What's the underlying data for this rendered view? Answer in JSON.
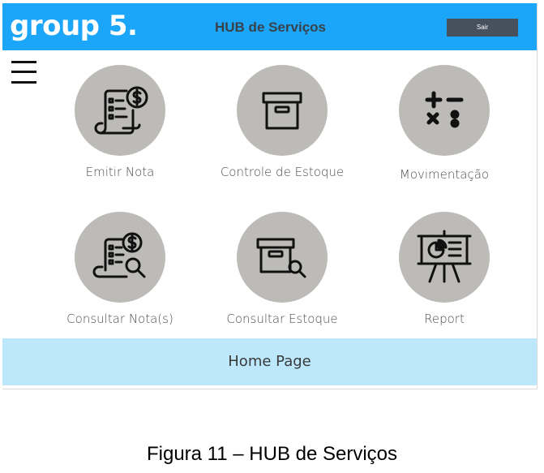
{
  "header": {
    "logo": "group 5.",
    "title": "HUB de Serviços",
    "logout_label": "Sair",
    "background_color": "#1ba6f9"
  },
  "menu": {
    "icon": "hamburger-menu-icon"
  },
  "tiles": [
    {
      "label": "Emitir Nota",
      "icon": "invoice-dollar-icon"
    },
    {
      "label": "Controle de Estoque",
      "icon": "archive-box-icon"
    },
    {
      "label": "Movimentação",
      "icon": "math-operations-icon"
    },
    {
      "label": "Consultar Nota(s)",
      "icon": "invoice-search-icon"
    },
    {
      "label": "Consultar Estoque",
      "icon": "archive-box-search-icon"
    },
    {
      "label": "Report",
      "icon": "presentation-chart-icon"
    }
  ],
  "footer": {
    "label": "Home Page",
    "background_color": "#bde8fc"
  },
  "caption": "Figura 11 – HUB de Serviços"
}
